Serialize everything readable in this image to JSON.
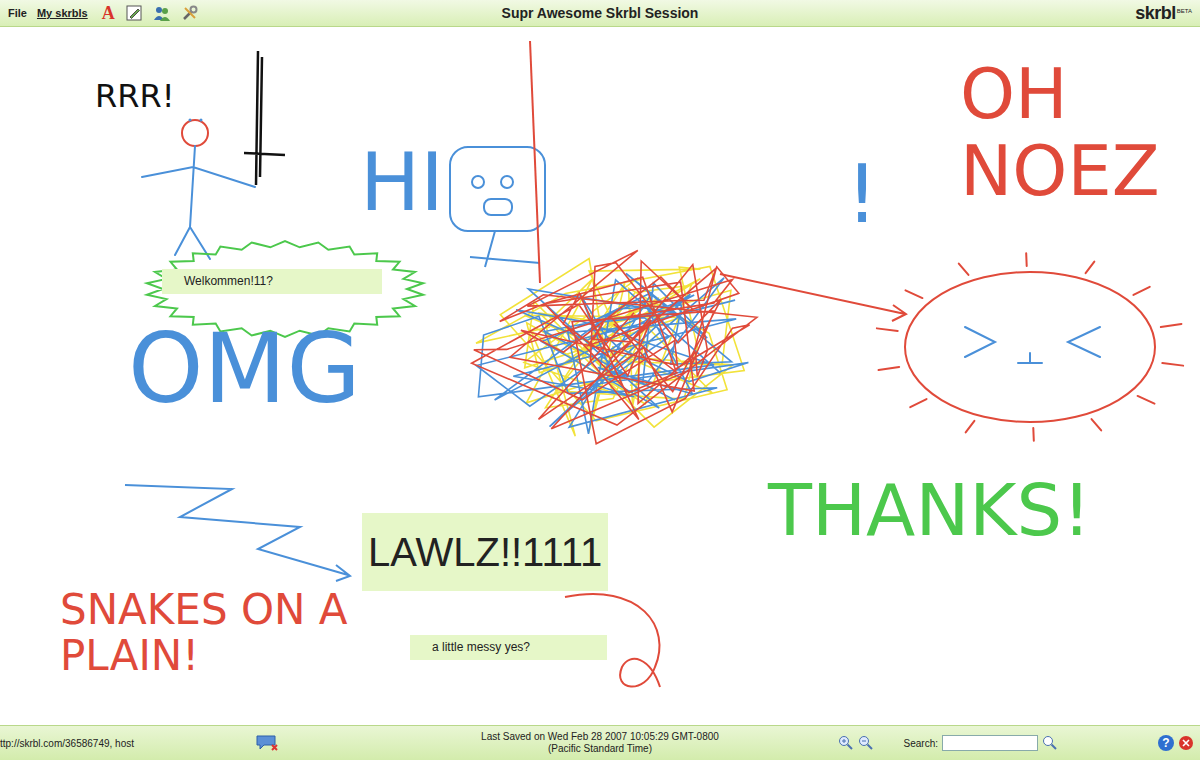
{
  "window": {
    "title": "Supr Awesome Skrbl Session"
  },
  "menu": [
    "File",
    "My skrbls"
  ],
  "text_tool": "A",
  "logo": {
    "text": "skrbl",
    "badge": "BETA"
  },
  "handwriting": [
    {
      "text": "RRR!",
      "color": "#111111"
    },
    {
      "text": "HI",
      "color": "#4a90d9"
    },
    {
      "text": "OMG",
      "color": "#4a90d9"
    },
    {
      "text": "!",
      "color": "#4a90d9"
    },
    {
      "text": "OH NOEZ",
      "color": "#e04a3a"
    },
    {
      "text": "THANKS!",
      "color": "#4cc84c"
    },
    {
      "text": "SNAKES ON A PLAIN!",
      "color": "#e04a3a"
    }
  ],
  "notes": [
    {
      "text": "Welkommen!11?",
      "kind": "small"
    },
    {
      "text": "LAWLZ!!1111",
      "kind": "large"
    },
    {
      "text": "a little messy yes?",
      "kind": "small"
    }
  ],
  "status_bar": {
    "url": "ttp://skrbl.com/36586749, host",
    "saved": "Last Saved on Wed Feb 28 2007 10:05:29 GMT-0800 (Pacific Standard Time)",
    "search_label": "Search:",
    "search_value": "",
    "help": "?"
  }
}
